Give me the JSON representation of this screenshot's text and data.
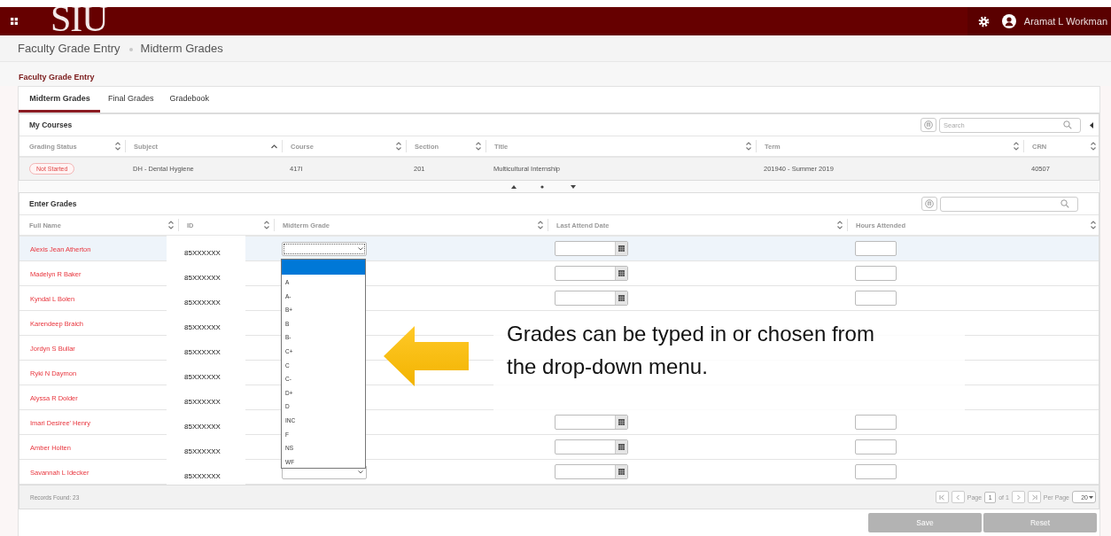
{
  "header": {
    "logo": "SIU",
    "user": "Aramat L Workman"
  },
  "breadcrumb": [
    "Faculty Grade Entry",
    "Midterm Grades"
  ],
  "page_title": "Faculty Grade Entry",
  "tabs": [
    {
      "label": "Midterm Grades",
      "selected": true
    },
    {
      "label": "Final Grades",
      "selected": false
    },
    {
      "label": "Gradebook",
      "selected": false
    }
  ],
  "my_courses": {
    "title": "My Courses",
    "search_placeholder": "Search",
    "columns": [
      {
        "label": "Grading Status",
        "sorted": false,
        "kind": "status"
      },
      {
        "label": "Subject",
        "sorted": true,
        "kind": "text"
      },
      {
        "label": "Course",
        "sorted": false,
        "kind": "text"
      },
      {
        "label": "Section",
        "sorted": false,
        "kind": "text"
      },
      {
        "label": "Title",
        "sorted": false,
        "kind": "text"
      },
      {
        "label": "Term",
        "sorted": false,
        "kind": "text"
      },
      {
        "label": "CRN",
        "sorted": false,
        "kind": "text"
      }
    ],
    "rows": [
      {
        "cells": [
          "Not Started",
          "DH - Dental Hygiene",
          "417I",
          "201",
          "Multicultural Internship",
          "201940 - Summer 2019",
          "40507"
        ]
      }
    ]
  },
  "enter_grades": {
    "title": "Enter Grades",
    "columns": [
      {
        "label": "Full Name",
        "sorted": false
      },
      {
        "label": "ID",
        "sorted": false
      },
      {
        "label": "Midterm Grade",
        "sorted": false
      },
      {
        "label": "Last Attend Date",
        "sorted": false
      },
      {
        "label": "Hours Attended",
        "sorted": false
      }
    ],
    "rows": [
      {
        "name": "Alexis Jean Atherton",
        "id": "85XXXXXX",
        "selected": true
      },
      {
        "name": "Madelyn R Baker",
        "id": "85XXXXXX",
        "selected": false
      },
      {
        "name": "Kyndal L Bolen",
        "id": "85XXXXXX",
        "selected": false
      },
      {
        "name": "Karendeep Braich",
        "id": "85XXXXXX",
        "selected": false
      },
      {
        "name": "Jordyn S Bullar",
        "id": "85XXXXXX",
        "selected": false
      },
      {
        "name": "Ryki N Daymon",
        "id": "85XXXXXX",
        "selected": false
      },
      {
        "name": "Alyssa R Dolder",
        "id": "85XXXXXX",
        "selected": false
      },
      {
        "name": "Imari Desiree' Henry",
        "id": "85XXXXXX",
        "selected": false
      },
      {
        "name": "Amber Holten",
        "id": "85XXXXXX",
        "selected": false
      },
      {
        "name": "Savannah L Idecker",
        "id": "85XXXXXX",
        "selected": false
      }
    ],
    "grade_menu": {
      "open": true,
      "options": [
        {
          "kind": "blank",
          "selected": true
        },
        {
          "kind": "grade",
          "label": "A",
          "selected": false
        },
        {
          "kind": "grade",
          "label": "A-",
          "selected": false
        },
        {
          "kind": "grade",
          "label": "B+",
          "selected": false
        },
        {
          "kind": "grade",
          "label": "B",
          "selected": false
        },
        {
          "kind": "grade",
          "label": "B-",
          "selected": false
        },
        {
          "kind": "grade",
          "label": "C+",
          "selected": false
        },
        {
          "kind": "grade",
          "label": "C",
          "selected": false
        },
        {
          "kind": "grade",
          "label": "C-",
          "selected": false
        },
        {
          "kind": "grade",
          "label": "D+",
          "selected": false
        },
        {
          "kind": "grade",
          "label": "D",
          "selected": false
        },
        {
          "kind": "grade",
          "label": "INC",
          "selected": false
        },
        {
          "kind": "grade",
          "label": "F",
          "selected": false
        },
        {
          "kind": "grade",
          "label": "NS",
          "selected": false
        },
        {
          "kind": "grade",
          "label": "WF",
          "selected": false
        }
      ]
    },
    "records_found": "Records Found: 23",
    "pagination": {
      "page_label": "Page",
      "page": "1",
      "of": "of 1",
      "per_page_label": "Per Page",
      "per_page": "20"
    }
  },
  "buttons": [
    {
      "label": "Save",
      "disabled": true
    },
    {
      "label": "Reset",
      "disabled": true
    }
  ],
  "callout": {
    "text": "Grades can be typed in or chosen from the drop-down menu."
  }
}
